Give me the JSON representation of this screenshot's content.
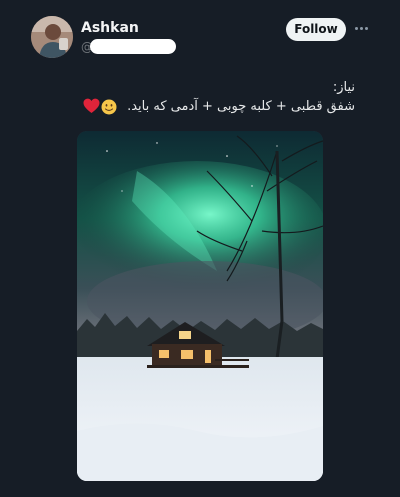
{
  "author": {
    "name": "Ashkan",
    "handle_prefix": "@"
  },
  "actions": {
    "follow_label": "Follow"
  },
  "post": {
    "line1": "نیاز:",
    "line2": "شفق قطبی + کلبه چوبی + آدمی که باید."
  },
  "icons": {
    "more": "more-horizontal-icon",
    "heart": "red-heart-emoji",
    "smile": "slightly-smiling-face-emoji"
  },
  "colors": {
    "background": "#161d26",
    "follow_button": "#eff3f4",
    "aurora": "#3fe0a8",
    "heart": "#e0243a",
    "smile": "#f6c64a"
  }
}
